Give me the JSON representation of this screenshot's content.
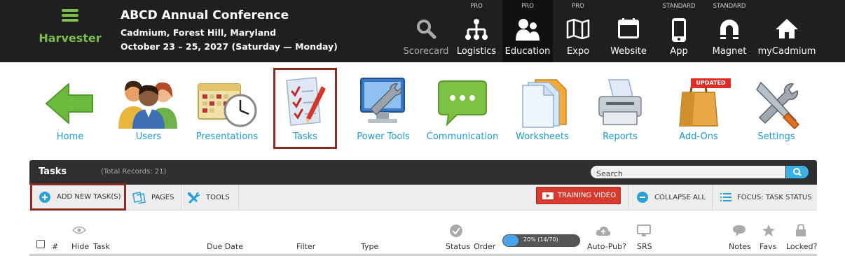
{
  "brand": {
    "name": "Harvester"
  },
  "conference": {
    "title": "ABCD Annual Conference",
    "location": "Cadmium, Forest Hill, Maryland",
    "dates": "October 23 – 25, 2027 (Saturday — Monday)"
  },
  "topnav": [
    {
      "label": "Scorecard",
      "tier": "",
      "icon": "magnifier-icon"
    },
    {
      "label": "Logistics",
      "tier": "PRO",
      "icon": "org-chart-icon"
    },
    {
      "label": "Education",
      "tier": "PRO",
      "icon": "people-icon"
    },
    {
      "label": "Expo",
      "tier": "PRO",
      "icon": "map-icon"
    },
    {
      "label": "Website",
      "tier": "",
      "icon": "browser-icon"
    },
    {
      "label": "App",
      "tier": "STANDARD",
      "icon": "phone-icon"
    },
    {
      "label": "Magnet",
      "tier": "STANDARD",
      "icon": "magnet-icon"
    },
    {
      "label": "myCadmium",
      "tier": "",
      "icon": "home-icon"
    }
  ],
  "modules": [
    {
      "label": "Home"
    },
    {
      "label": "Users"
    },
    {
      "label": "Presentations"
    },
    {
      "label": "Tasks"
    },
    {
      "label": "Power Tools"
    },
    {
      "label": "Communication"
    },
    {
      "label": "Worksheets"
    },
    {
      "label": "Reports"
    },
    {
      "label": "Add-Ons",
      "badge": "UPDATED"
    },
    {
      "label": "Settings"
    }
  ],
  "panel": {
    "title": "Tasks",
    "count": "(Total Records: 21)",
    "search_placeholder": "Search"
  },
  "toolbar": {
    "add": "ADD NEW TASK(S)",
    "pages": "PAGES",
    "tools": "TOOLS",
    "training": "TRAINING VIDEO",
    "collapse": "COLLAPSE ALL",
    "focus": "FOCUS: TASK STATUS"
  },
  "columns": {
    "num": "#",
    "hide": "Hide",
    "task": "Task",
    "due": "Due Date",
    "filter": "Filter",
    "type": "Type",
    "status": "Status",
    "order": "Order",
    "autopub": "Auto-Pub?",
    "srs": "SRS",
    "notes": "Notes",
    "favs": "Favs",
    "locked": "Locked?"
  },
  "progress": {
    "text": "20% (14/70)",
    "fraction": 0.2
  },
  "colors": {
    "accent": "#1e9bd2",
    "brand": "#7cbd4a",
    "alert": "#d93a2f",
    "selected_border": "#8c2b22"
  }
}
